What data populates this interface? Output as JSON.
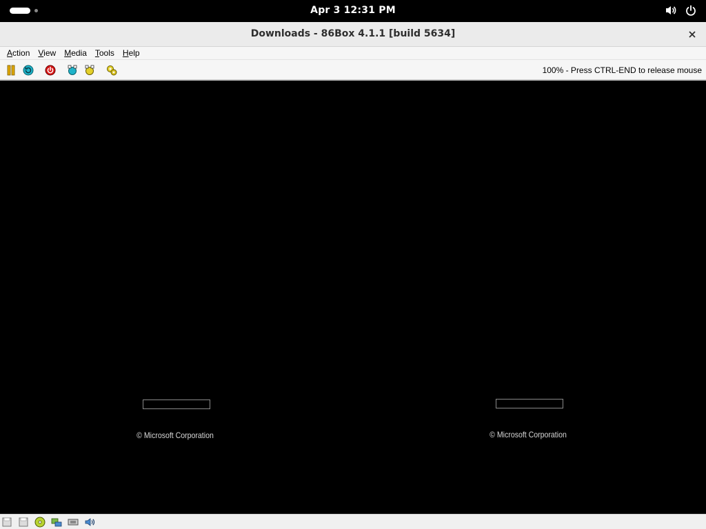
{
  "topbar": {
    "clock": "Apr 3  12:31 PM",
    "icons": [
      "volume-icon",
      "power-icon"
    ]
  },
  "window": {
    "title": "Downloads - 86Box 4.1.1 [build 5634]",
    "close_icon": "close-icon"
  },
  "menubar": {
    "items": [
      {
        "mnemonic": "A",
        "rest": "ction"
      },
      {
        "mnemonic": "V",
        "rest": "iew"
      },
      {
        "mnemonic": "M",
        "rest": "edia"
      },
      {
        "mnemonic": "T",
        "rest": "ools"
      },
      {
        "mnemonic": "H",
        "rest": "elp"
      }
    ]
  },
  "toolbar": {
    "buttons": [
      "pause-icon",
      "reset-icon",
      "power-off-icon",
      "ctrl-alt-del-icon",
      "ctrl-alt-esc-icon",
      "settings-icon"
    ],
    "status": "100% - Press CTRL-END to release mouse"
  },
  "screen": {
    "left": {
      "copyright": "© Microsoft Corporation",
      "progress": 0
    },
    "right": {
      "copyright": "© Microsoft Corporation",
      "progress": 0
    }
  },
  "statusbar": {
    "icons": [
      "floppy-a-icon",
      "floppy-b-icon",
      "cdrom-icon",
      "hard-disk-icon",
      "network-icon",
      "sound-icon"
    ]
  },
  "colors": {
    "titlebar": "#ebebeb",
    "toolbar": "#f6f6f6",
    "screen": "#000000"
  }
}
